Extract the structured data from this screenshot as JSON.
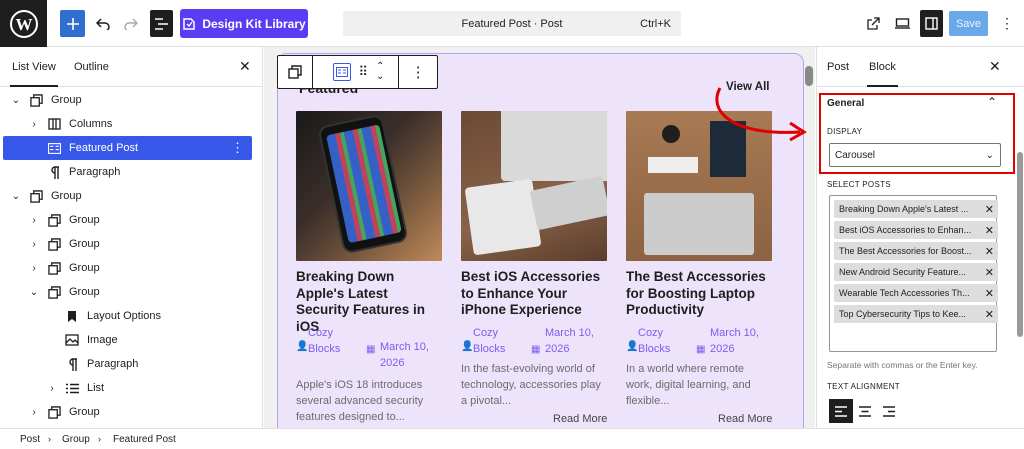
{
  "toolbar": {
    "design_kit_label": "Design Kit Library",
    "command_title": "Featured Post · Post",
    "command_shortcut": "Ctrl+K",
    "save_label": "Save"
  },
  "list_view": {
    "tabs": [
      "List View",
      "Outline"
    ],
    "items": [
      {
        "label": "Group",
        "chev": "⌄",
        "icon": "group-icon"
      },
      {
        "label": "Columns",
        "chev": "›",
        "icon": "columns-icon"
      },
      {
        "label": "Featured Post",
        "chev": "",
        "icon": "featured-post-icon"
      },
      {
        "label": "Paragraph",
        "chev": "",
        "icon": "paragraph-icon"
      },
      {
        "label": "Group",
        "chev": "⌄",
        "icon": "group-icon"
      },
      {
        "label": "Group",
        "chev": "›",
        "icon": "group-icon"
      },
      {
        "label": "Group",
        "chev": "›",
        "icon": "group-icon"
      },
      {
        "label": "Group",
        "chev": "›",
        "icon": "group-icon"
      },
      {
        "label": "Group",
        "chev": "⌄",
        "icon": "group-icon"
      },
      {
        "label": "Layout Options",
        "chev": "",
        "icon": "bookmark-icon"
      },
      {
        "label": "Image",
        "chev": "",
        "icon": "image-icon"
      },
      {
        "label": "Paragraph",
        "chev": "",
        "icon": "paragraph-icon"
      },
      {
        "label": "List",
        "chev": "›",
        "icon": "list-icon"
      },
      {
        "label": "Group",
        "chev": "›",
        "icon": "group-icon"
      }
    ]
  },
  "canvas": {
    "heading": "Featured",
    "view_all": "View All",
    "posts": [
      {
        "title": "Breaking Down Apple's Latest Security Features in iOS",
        "author": "Cozy Blocks",
        "date": "March 10, 2026",
        "excerpt": "Apple's iOS 18 introduces several advanced security features designed to...",
        "read_more": ""
      },
      {
        "title": "Best iOS Accessories to Enhance Your iPhone Experience",
        "author": "Cozy Blocks",
        "date": "March 10, 2026",
        "excerpt": "In the fast-evolving world of technology, accessories play a pivotal...",
        "read_more": "Read More"
      },
      {
        "title": "The Best Accessories for Boosting Laptop Productivity",
        "author": "Cozy Blocks",
        "date": "March 10, 2026",
        "excerpt": "In a world where remote work, digital learning, and flexible...",
        "read_more": "Read More"
      }
    ]
  },
  "settings": {
    "tabs": [
      "Post",
      "Block"
    ],
    "section_title": "General",
    "display_label": "DISPLAY",
    "display_value": "Carousel",
    "select_posts_label": "SELECT POSTS",
    "selected_posts": [
      "Breaking Down Apple's Latest ...",
      "Best iOS Accessories to Enhan...",
      "The Best Accessories for Boost...",
      "New Android Security Feature...",
      "Wearable Tech Accessories Th...",
      "Top Cybersecurity Tips to Kee..."
    ],
    "help_text": "Separate with commas or the Enter key.",
    "text_alignment_label": "TEXT ALIGNMENT"
  },
  "breadcrumb": [
    "Post",
    "Group",
    "Featured Post"
  ],
  "colors": {
    "accent": "#3858e9",
    "design_kit": "#5b3cf5",
    "annotation": "#e00000",
    "panel": "#ede4fb"
  }
}
